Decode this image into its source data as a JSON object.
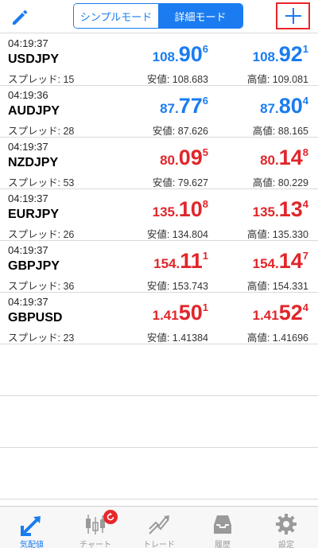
{
  "header": {
    "segment": {
      "simple": "シンプルモード",
      "detail": "詳細モード",
      "active": "detail"
    },
    "icons": {
      "edit": "pencil-icon",
      "add": "plus-icon"
    }
  },
  "quotes": [
    {
      "time": "04:19:37",
      "symbol": "USDJPY",
      "spread_label": "スプレッド: 15",
      "color": "#1a7cf0",
      "bid": {
        "prefix": "108.",
        "big": "90",
        "sup": "6"
      },
      "ask": {
        "prefix": "108.",
        "big": "92",
        "sup": "1"
      },
      "low": "安値: 108.683",
      "high": "高値: 109.081"
    },
    {
      "time": "04:19:36",
      "symbol": "AUDJPY",
      "spread_label": "スプレッド: 28",
      "color": "#1a7cf0",
      "bid": {
        "prefix": "87.",
        "big": "77",
        "sup": "6"
      },
      "ask": {
        "prefix": "87.",
        "big": "80",
        "sup": "4"
      },
      "low": "安値: 87.626",
      "high": "高値: 88.165"
    },
    {
      "time": "04:19:37",
      "symbol": "NZDJPY",
      "spread_label": "スプレッド: 53",
      "color": "#e0262b",
      "bid": {
        "prefix": "80.",
        "big": "09",
        "sup": "5"
      },
      "ask": {
        "prefix": "80.",
        "big": "14",
        "sup": "8"
      },
      "low": "安値: 79.627",
      "high": "高値: 80.229"
    },
    {
      "time": "04:19:37",
      "symbol": "EURJPY",
      "spread_label": "スプレッド: 26",
      "color": "#e0262b",
      "bid": {
        "prefix": "135.",
        "big": "10",
        "sup": "8"
      },
      "ask": {
        "prefix": "135.",
        "big": "13",
        "sup": "4"
      },
      "low": "安値: 134.804",
      "high": "高値: 135.330"
    },
    {
      "time": "04:19:37",
      "symbol": "GBPJPY",
      "spread_label": "スプレッド: 36",
      "color": "#e0262b",
      "bid": {
        "prefix": "154.",
        "big": "11",
        "sup": "1"
      },
      "ask": {
        "prefix": "154.",
        "big": "14",
        "sup": "7"
      },
      "low": "安値: 153.743",
      "high": "高値: 154.331"
    },
    {
      "time": "04:19:37",
      "symbol": "GBPUSD",
      "spread_label": "スプレッド: 23",
      "color": "#e0262b",
      "bid": {
        "prefix": "1.41",
        "big": "50",
        "sup": "1"
      },
      "ask": {
        "prefix": "1.41",
        "big": "52",
        "sup": "4"
      },
      "low": "安値: 1.41384",
      "high": "高値: 1.41696"
    }
  ],
  "tabbar": {
    "tabs": [
      {
        "label": "気配値",
        "icon": "quotes-arrows-icon",
        "active": true
      },
      {
        "label": "チャート",
        "icon": "candlestick-chart-icon",
        "active": false
      },
      {
        "label": "トレード",
        "icon": "trade-trend-icon",
        "active": false
      },
      {
        "label": "履歴",
        "icon": "history-inbox-icon",
        "active": false
      },
      {
        "label": "設定",
        "icon": "settings-gear-icon",
        "active": false
      }
    ],
    "chart_badge_icon": "refresh-badge-icon"
  },
  "colors": {
    "accent": "#1a7cf0",
    "down": "#e0262b",
    "highlight_box": "#e8262a"
  }
}
